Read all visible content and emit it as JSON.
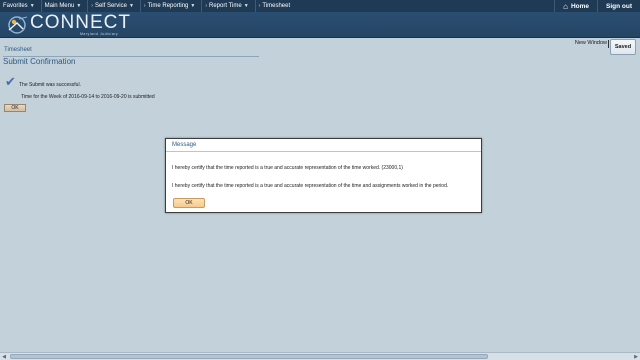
{
  "nav": {
    "items": [
      {
        "label": "Favorites"
      },
      {
        "label": "Main Menu"
      },
      {
        "label": "Self Service"
      },
      {
        "label": "Time Reporting"
      },
      {
        "label": "Report Time"
      },
      {
        "label": "Timesheet"
      }
    ],
    "home_label": "Home",
    "signout_label": "Sign out"
  },
  "banner": {
    "logo_text": "CONNECT",
    "logo_sub": "Maryland Judiciary"
  },
  "header": {
    "new_window_label": "New Window",
    "saved_label": "Saved"
  },
  "page": {
    "breadcrumb": "Timesheet",
    "title": "Submit Confirmation",
    "success_text": "The Submit was successful.",
    "week_text": "Time for the Week of 2016-09-14 to  2016-09-20 is submitted",
    "ok_label": "OK"
  },
  "dialog": {
    "title": "Message",
    "line1": "I hereby certify that the time reported is a true and accurate representation of the time worked. (23000,1)",
    "line2": "I hereby certify that the time reported is a true and accurate representation of the time and assignments worked in the period.",
    "ok_label": "OK"
  },
  "colors": {
    "nav_bg": "#1f3a55",
    "banner_bg": "#2a4e71",
    "page_bg": "#c2d1da",
    "accent_text": "#2e5b86",
    "ok_button": "#f7c98e"
  }
}
